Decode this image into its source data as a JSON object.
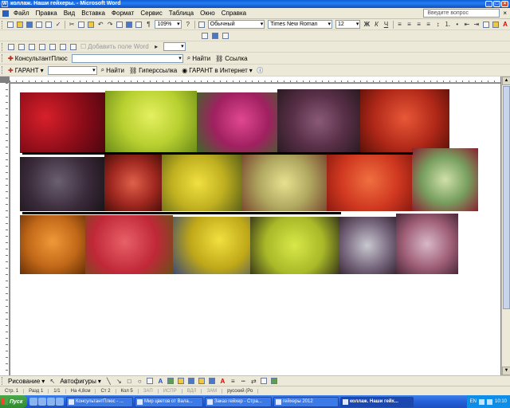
{
  "window": {
    "title": "коллаж. Наши гейхеры. - Microsoft Word"
  },
  "menu": {
    "items": [
      "Файл",
      "Правка",
      "Вид",
      "Вставка",
      "Формат",
      "Сервис",
      "Таблица",
      "Окно",
      "Справка"
    ],
    "help_placeholder": "Введите вопрос"
  },
  "toolbar_format": {
    "zoom": "109%",
    "style": "Обычный",
    "font": "Times New Roman",
    "size": "12"
  },
  "toolbar_forms": {
    "add_field": "Добавить поле Word"
  },
  "toolbar_consultant": {
    "name": "КонсультантПлюс",
    "find": "Найти",
    "link": "Ссылка"
  },
  "toolbar_garant": {
    "name": "ГАРАНТ",
    "find": "Найти",
    "hyperlink": "Гиперссылка",
    "internet": "ГАРАНТ в Интернет"
  },
  "drawing_toolbar": {
    "draw": "Рисование",
    "autoshapes": "Автофигуры"
  },
  "status": {
    "page": "Стр. 1",
    "section": "Разд 1",
    "pages": "1/1",
    "at": "На 4,8см",
    "line": "Ст 2",
    "col": "Кол 5",
    "rec": "ЗАП",
    "trk": "ИСПР",
    "ext": "ВДЛ",
    "ovr": "ЗАМ",
    "lang": "русский (Ро"
  },
  "taskbar": {
    "start": "Пуск",
    "tasks": [
      "КонсультантПлюс - ...",
      "Мир цветов от Вала...",
      "Заказ гейхер - Стра...",
      "гейхеры 2012",
      "коллаж. Наши гейх..."
    ],
    "lang": "EN",
    "clock": "10:10"
  },
  "colors": {
    "accent": "#0a5fd8",
    "chrome": "#ece9d8"
  }
}
